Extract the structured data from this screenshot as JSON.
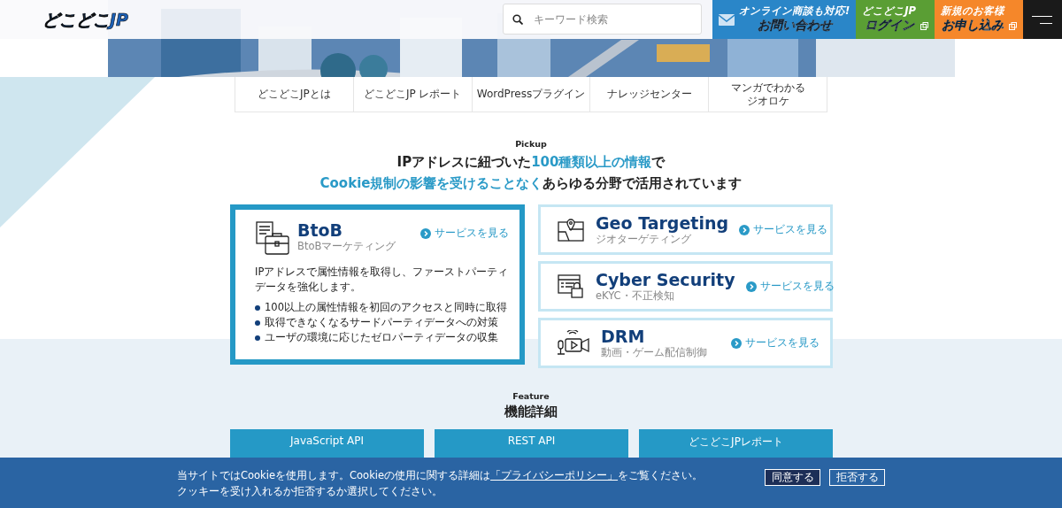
{
  "header": {
    "logo": "どこどこJP",
    "search": {
      "placeholder": "キーワード検索"
    },
    "actions": [
      {
        "kind": "contact",
        "caption": "オンライン商談も対応!",
        "label": "お問い合わせ",
        "color": "#2a86c8"
      },
      {
        "kind": "login",
        "caption": "どこどこJP",
        "label": "ログイン",
        "color": "#5a9e34"
      },
      {
        "kind": "apply",
        "caption": "新規のお客様",
        "label": "お申し込み",
        "color": "#f5872a"
      }
    ]
  },
  "nav": [
    [
      "どこどこJPとは"
    ],
    [
      "どこどこJP レポート"
    ],
    [
      "WordPressプラグイン"
    ],
    [
      "ナレッジセンター"
    ],
    [
      "マンガでわかる",
      "ジオロケ"
    ]
  ],
  "pickup": {
    "eyebrow": "Pickup",
    "headline": [
      [
        {
          "text": "IPアドレスに紐づいた",
          "highlight": false
        },
        {
          "text": "100種類以上の情報",
          "highlight": true
        },
        {
          "text": "で",
          "highlight": false
        }
      ],
      [
        {
          "text": "Cookie規制の影響を受けることなく",
          "highlight": true
        },
        {
          "text": "あらゆる分野で活用されています",
          "highlight": false
        }
      ]
    ],
    "main": {
      "title": "BtoB",
      "subtitle": "BtoBマーケティング",
      "link": "サービスを見る",
      "description": "IPアドレスで属性情報を取得し、ファーストパーティデータを強化します。",
      "bullets": [
        "100以上の属性情報を初回のアクセスと同時に取得",
        "取得できなくなるサードパーティデータへの対策",
        "ユーザの環境に応じたゼロパーティデータの収集"
      ]
    },
    "services": [
      {
        "title": "Geo Targeting",
        "subtitle": "ジオターゲティング",
        "link": "サービスを見る"
      },
      {
        "title": "Cyber Security",
        "subtitle": "eKYC・不正検知",
        "link": "サービスを見る"
      },
      {
        "title": "DRM",
        "subtitle": "動画・ゲーム配信制御",
        "link": "サービスを見る"
      }
    ]
  },
  "feature": {
    "eyebrow": "Feature",
    "title": "機能詳細",
    "tiles": [
      "JavaScript API",
      "REST API",
      "どこどこJPレポート"
    ]
  },
  "cookie_banner": {
    "text_before": "当サイトではCookieを使用します。Cookieの使用に関する詳細は",
    "link": "「プライバシーポリシー」",
    "text_after": "をご覧ください。",
    "line2": "クッキーを受け入れるか拒否するか選択してください。",
    "buttons": [
      {
        "label": "同意する",
        "primary": true
      },
      {
        "label": "拒否する",
        "primary": false
      }
    ]
  }
}
